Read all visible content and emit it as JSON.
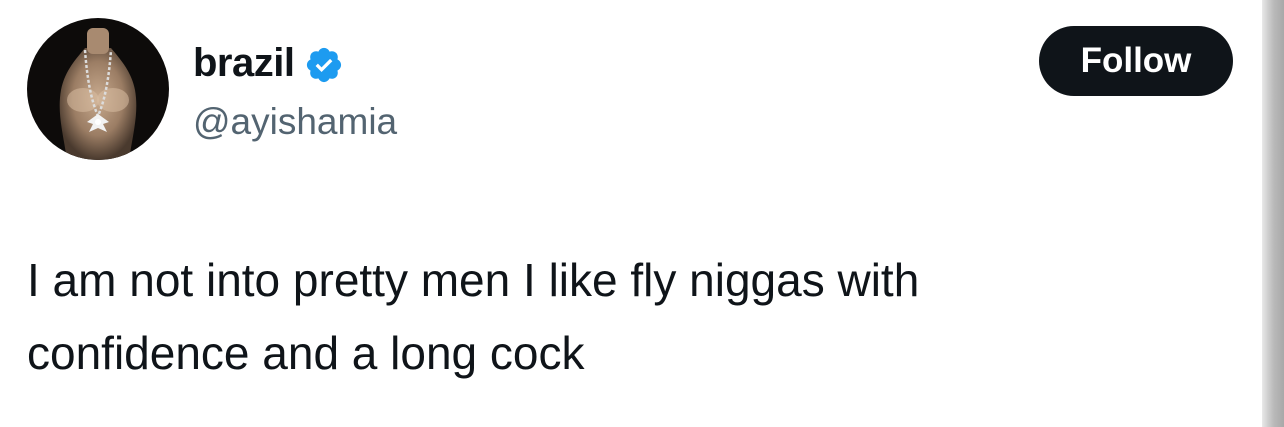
{
  "user": {
    "display_name": "brazil",
    "handle": "@ayishamia",
    "avatar_icon": "avatar-image",
    "verified_icon": "verified-badge-icon",
    "verified_color": "#1d9bf0"
  },
  "actions": {
    "follow_label": "Follow"
  },
  "tweet": {
    "text_line_1": "I am not into pretty men I like fly niggas with",
    "text_line_2": "confidence and a long cock"
  },
  "colors": {
    "text_primary": "#0f1419",
    "text_secondary": "#536471",
    "button_bg": "#0f1419",
    "button_text": "#ffffff"
  }
}
